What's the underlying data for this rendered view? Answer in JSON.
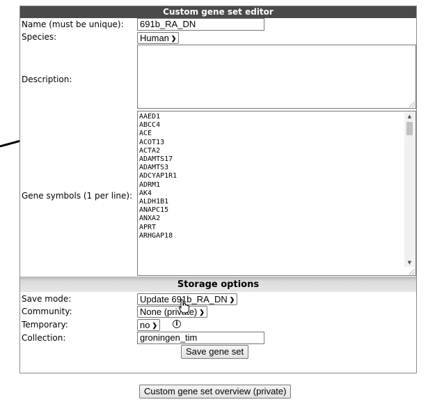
{
  "editor": {
    "title": "Custom gene set editor",
    "name_label": "Name (must be unique):",
    "name_value": "691b_RA_DN",
    "species_label": "Species:",
    "species_value": "Human",
    "description_label": "Description:",
    "description_value": "",
    "genes_label": "Gene symbols (1 per line):",
    "genes": [
      "AAED1",
      "ABCC4",
      "ACE",
      "ACOT13",
      "ACTA2",
      "ADAMTS17",
      "ADAMTS3",
      "ADCYAP1R1",
      "ADRM1",
      "AK4",
      "ALDH1B1",
      "ANAPC15",
      "ANXA2",
      "APRT",
      "ARHGAP18"
    ]
  },
  "storage": {
    "title": "Storage options",
    "save_mode_label": "Save mode:",
    "save_mode_value": "Update 691b_RA_DN",
    "community_label": "Community:",
    "community_value": "None (private)",
    "temporary_label": "Temporary:",
    "temporary_value": "no",
    "collection_label": "Collection:",
    "collection_value": "groningen_tim",
    "save_button": "Save gene set"
  },
  "overview_button": "Custom gene set overview (private)",
  "icons": {
    "chevron": "chevron-down-icon",
    "info": "info-icon",
    "cursor": "hand-pointer-icon",
    "annotation": "arrow-icon"
  }
}
